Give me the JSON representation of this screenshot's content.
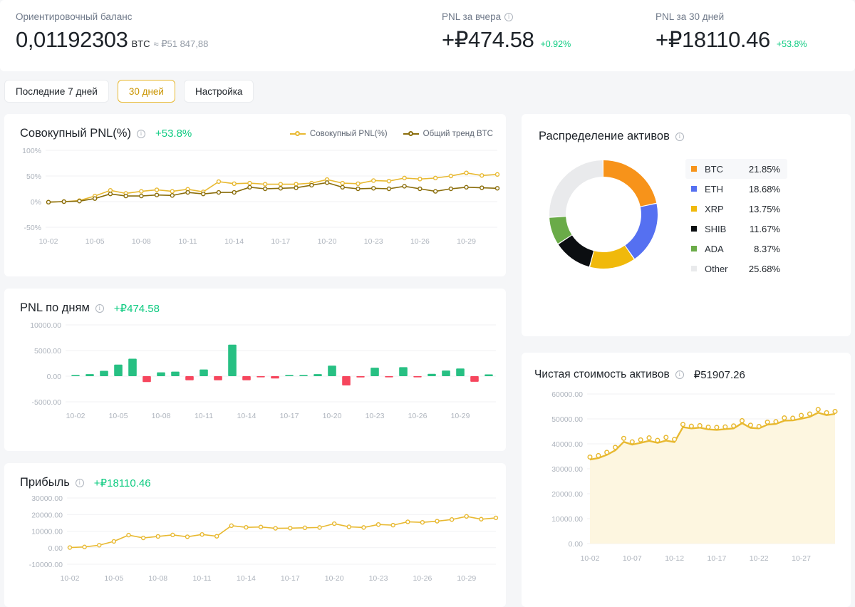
{
  "summary": {
    "balance": {
      "label": "Ориентировочный баланс",
      "value": "0,01192303",
      "unit": "BTC",
      "approx": "≈ ₽51 847,88"
    },
    "yesterday": {
      "label": "PNL за вчера",
      "value": "+₽474.58",
      "percent": "+0.92%",
      "info_icon": "info-icon"
    },
    "month": {
      "label": "PNL за 30 дней",
      "value": "+₽18110.46",
      "percent": "+53.8%"
    }
  },
  "filters": [
    {
      "label": "Последние 7 дней",
      "active": false
    },
    {
      "label": "30 дней",
      "active": true
    },
    {
      "label": "Настройка",
      "active": false
    }
  ],
  "colors": {
    "accent_yellow": "#e8b931",
    "trend_brown": "#8a6d0b",
    "green": "#0ecb81",
    "red": "#f6465d",
    "btc": "#f7931a",
    "eth": "#5570f1",
    "xrp": "#f0b90b",
    "shib": "#0b0e11",
    "ada": "#6aab48",
    "other": "#e9eaec"
  },
  "cards": {
    "cumulative_pnl": {
      "title": "Совокупный PNL(%)",
      "info_icon": "info-icon",
      "delta": "+53.8%",
      "legend": [
        "Совокупный PNL(%)",
        "Общий тренд BTC"
      ]
    },
    "daily_pnl": {
      "title": "PNL по дням",
      "info_icon": "info-icon",
      "delta": "+₽474.58"
    },
    "profit": {
      "title": "Прибыль",
      "info_icon": "info-icon",
      "delta": "+₽18110.46"
    },
    "asset_distribution": {
      "title": "Распределение активов",
      "info_icon": "info-icon"
    },
    "net_asset_value": {
      "title": "Чистая стоимость активов",
      "info_icon": "info-icon",
      "value": "₽51907.26"
    }
  },
  "chart_data": [
    {
      "id": "cumulative_pnl",
      "type": "line",
      "title": "Совокупный PNL(%)",
      "xlabel": "",
      "ylabel": "",
      "ylim": [
        -50,
        100
      ],
      "yticks": [
        "-50%",
        "0%",
        "50%",
        "100%"
      ],
      "ytick_values": [
        -50,
        0,
        50,
        100
      ],
      "grid": true,
      "legend_position": "top-right",
      "x": [
        "10-02",
        "10-03",
        "10-04",
        "10-05",
        "10-06",
        "10-07",
        "10-08",
        "10-09",
        "10-10",
        "10-11",
        "10-12",
        "10-13",
        "10-14",
        "10-15",
        "10-16",
        "10-17",
        "10-18",
        "10-19",
        "10-20",
        "10-21",
        "10-22",
        "10-23",
        "10-24",
        "10-25",
        "10-26",
        "10-27",
        "10-28",
        "10-29",
        "10-30",
        "10-31"
      ],
      "series": [
        {
          "name": "Совокупный PNL(%)",
          "color": "#e8b931",
          "values": [
            -1,
            0,
            2,
            11,
            22,
            16,
            20,
            23,
            20,
            24,
            19,
            39,
            35,
            36,
            34,
            34,
            34,
            36,
            43,
            36,
            35,
            41,
            40,
            46,
            44,
            46,
            50,
            56,
            51,
            53
          ]
        },
        {
          "name": "Общий тренд BTC",
          "color": "#8a6d0b",
          "values": [
            -1,
            0,
            1,
            6,
            15,
            11,
            11,
            13,
            12,
            18,
            15,
            18,
            18,
            28,
            25,
            26,
            27,
            32,
            37,
            28,
            25,
            26,
            25,
            30,
            25,
            20,
            25,
            28,
            27,
            26
          ]
        }
      ]
    },
    {
      "id": "daily_pnl",
      "type": "bar",
      "title": "PNL по дням",
      "xlabel": "",
      "ylabel": "",
      "ylim": [
        -5000,
        10000
      ],
      "yticks": [
        "-5000.00",
        "0.00",
        "5000.00",
        "10000.00"
      ],
      "ytick_values": [
        -5000,
        0,
        5000,
        10000
      ],
      "grid": true,
      "categories": [
        "10-02",
        "10-03",
        "10-04",
        "10-05",
        "10-06",
        "10-07",
        "10-08",
        "10-09",
        "10-10",
        "10-11",
        "10-12",
        "10-13",
        "10-14",
        "10-15",
        "10-16",
        "10-17",
        "10-18",
        "10-19",
        "10-20",
        "10-21",
        "10-22",
        "10-23",
        "10-24",
        "10-25",
        "10-26",
        "10-27",
        "10-28",
        "10-29",
        "10-30",
        "10-31"
      ],
      "values": [
        30,
        400,
        1050,
        2250,
        3400,
        -1150,
        750,
        880,
        -800,
        1300,
        -800,
        6150,
        -800,
        -80,
        -450,
        60,
        180,
        400,
        2050,
        -1800,
        -250,
        1650,
        -180,
        1750,
        -200,
        450,
        1100,
        1500,
        -1100,
        350
      ],
      "positive_color": "#27c083",
      "negative_color": "#f6465d"
    },
    {
      "id": "profit",
      "type": "line",
      "title": "Прибыль",
      "xlabel": "",
      "ylabel": "",
      "ylim": [
        -10000,
        30000
      ],
      "yticks": [
        "-10000.00",
        "0.00",
        "10000.00",
        "20000.00",
        "30000.00"
      ],
      "ytick_values": [
        -10000,
        0,
        10000,
        20000,
        30000
      ],
      "grid": true,
      "x": [
        "10-02",
        "10-03",
        "10-04",
        "10-05",
        "10-06",
        "10-07",
        "10-08",
        "10-09",
        "10-10",
        "10-11",
        "10-12",
        "10-13",
        "10-14",
        "10-15",
        "10-16",
        "10-17",
        "10-18",
        "10-19",
        "10-20",
        "10-21",
        "10-22",
        "10-23",
        "10-24",
        "10-25",
        "10-26",
        "10-27",
        "10-28",
        "10-29",
        "10-30",
        "10-31"
      ],
      "series": [
        {
          "name": "Прибыль",
          "color": "#e8b931",
          "values": [
            100,
            450,
            1500,
            3800,
            7600,
            5900,
            6800,
            7700,
            6600,
            8000,
            6900,
            13300,
            12300,
            12500,
            11700,
            11800,
            12000,
            12200,
            14500,
            12600,
            12200,
            14000,
            13600,
            15600,
            15300,
            16000,
            17000,
            18900,
            17200,
            18000
          ]
        }
      ]
    },
    {
      "id": "asset_distribution",
      "type": "pie",
      "title": "Распределение активов",
      "donut": true,
      "legend_position": "right",
      "labels": [
        "BTC",
        "ETH",
        "XRP",
        "SHIB",
        "ADA",
        "Other"
      ],
      "values": [
        21.85,
        18.68,
        13.75,
        11.67,
        8.37,
        25.68
      ],
      "display_values": [
        "21.85%",
        "18.68%",
        "13.75%",
        "11.67%",
        "8.37%",
        "25.68%"
      ],
      "colors": [
        "#f7931a",
        "#5570f1",
        "#f0b90b",
        "#0b0e11",
        "#6aab48",
        "#e9eaec"
      ]
    },
    {
      "id": "net_asset_value",
      "type": "area",
      "title": "Чистая стоимость активов",
      "xlabel": "",
      "ylabel": "",
      "ylim": [
        0,
        60000
      ],
      "yticks": [
        "0.00",
        "10000.00",
        "20000.00",
        "30000.00",
        "40000.00",
        "50000.00",
        "60000.00"
      ],
      "ytick_values": [
        0,
        10000,
        20000,
        30000,
        40000,
        50000,
        60000
      ],
      "xticks": [
        "10-02",
        "10-07",
        "10-12",
        "10-17",
        "10-22",
        "10-27"
      ],
      "grid": true,
      "x": [
        "10-02",
        "10-03",
        "10-04",
        "10-05",
        "10-06",
        "10-07",
        "10-08",
        "10-09",
        "10-10",
        "10-11",
        "10-12",
        "10-13",
        "10-14",
        "10-15",
        "10-16",
        "10-17",
        "10-18",
        "10-19",
        "10-20",
        "10-21",
        "10-22",
        "10-23",
        "10-24",
        "10-25",
        "10-26",
        "10-27",
        "10-28",
        "10-29",
        "10-30",
        "10-31"
      ],
      "series": [
        {
          "name": "Чистая стоимость активов",
          "color": "#e8b931",
          "fill": "#fdf6e0",
          "values": [
            33700,
            34300,
            35600,
            37400,
            40800,
            39700,
            40400,
            41200,
            40400,
            41300,
            40700,
            46700,
            46200,
            46500,
            45800,
            45600,
            45900,
            46200,
            48300,
            46400,
            46200,
            47700,
            48000,
            49300,
            49400,
            50100,
            50800,
            52500,
            51500,
            52000
          ]
        }
      ],
      "markers": [
        34700,
        35300,
        36600,
        38600,
        42200,
        40800,
        41600,
        42400,
        41400,
        42600,
        41800,
        47800,
        47100,
        47300,
        46700,
        46600,
        46800,
        47200,
        49300,
        47500,
        47000,
        48700,
        48900,
        50400,
        50300,
        51400,
        52000,
        53800,
        52500,
        53000
      ]
    }
  ]
}
